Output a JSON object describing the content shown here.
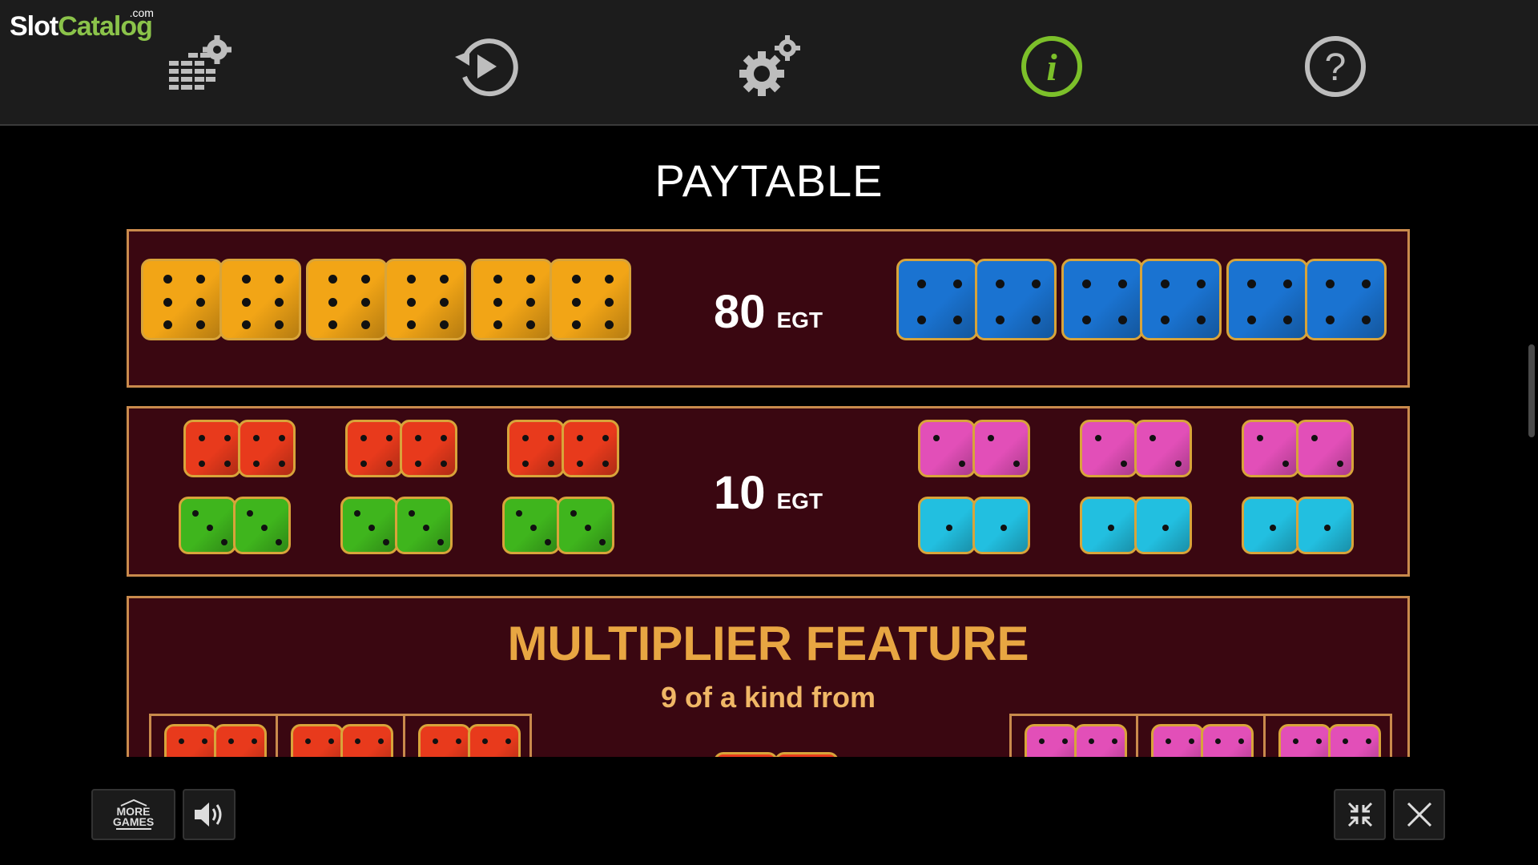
{
  "watermark": {
    "part1": "Slot",
    "part2": "Catalog",
    "suffix": ".com"
  },
  "toolbar": {
    "items": [
      {
        "name": "paytable-settings",
        "icon": "stack-gear-icon",
        "active": false
      },
      {
        "name": "autoplay",
        "icon": "replay-icon",
        "active": false
      },
      {
        "name": "settings",
        "icon": "gears-icon",
        "active": false
      },
      {
        "name": "info",
        "icon": "info-icon",
        "active": true
      },
      {
        "name": "help",
        "icon": "help-icon",
        "active": false
      }
    ]
  },
  "paytable": {
    "title": "PAYTABLE",
    "row1": {
      "value": "80",
      "currency": "EGT",
      "left_dice": "yellow",
      "right_dice": "blue"
    },
    "row2": {
      "value": "10",
      "currency": "EGT",
      "left_dice": [
        "red",
        "green"
      ],
      "right_dice": [
        "pink",
        "cyan"
      ]
    }
  },
  "multiplier": {
    "title": "MULTIPLIER FEATURE",
    "subtitle": "9 of a kind from"
  },
  "bottom": {
    "more_games_line1": "MORE",
    "more_games_line2": "GAMES"
  },
  "colors": {
    "panel": "#3a0711",
    "border": "#c98a4c",
    "accent_active": "#7cc02a",
    "yellow": "#f2a516",
    "blue": "#1a73d1",
    "red": "#e83a1c",
    "green": "#3fb51d",
    "pink": "#e24fb8",
    "cyan": "#22bfe0"
  }
}
